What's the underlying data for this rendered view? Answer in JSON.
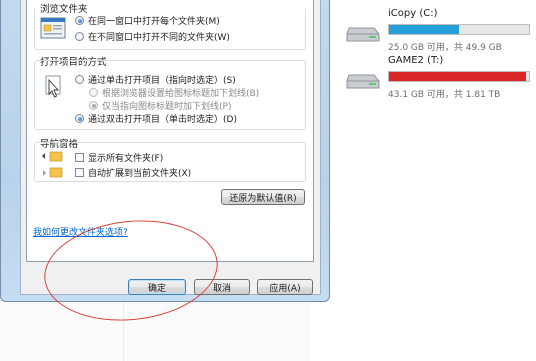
{
  "dialog": {
    "browse_group": {
      "title": "浏览文件夹",
      "options": [
        {
          "label": "在同一窗口中打开每个文件夹(M)",
          "selected": true
        },
        {
          "label": "在不同窗口中打开不同的文件夹(W)",
          "selected": false
        }
      ]
    },
    "click_group": {
      "title": "打开项目的方式",
      "options": [
        {
          "label": "通过单击打开项目（指向时选定）(S)",
          "selected": false,
          "disabled": false
        },
        {
          "label": "根据浏览器设置给图标标题加下划线(B)",
          "selected": false,
          "disabled": true
        },
        {
          "label": "仅当指向图标标题时加下划线(P)",
          "selected": true,
          "disabled": true
        },
        {
          "label": "通过双击打开项目（单击时选定）(D)",
          "selected": true,
          "disabled": false
        }
      ]
    },
    "nav_group": {
      "title": "导航窗格",
      "options": [
        {
          "label": "显示所有文件夹(F)",
          "checked": false
        },
        {
          "label": "自动扩展到当前文件夹(X)",
          "checked": false
        }
      ]
    },
    "restore_defaults_label": "还原为默认值(R)",
    "help_link": "我如何更改文件夹选项?",
    "buttons": {
      "ok": "确定",
      "cancel": "取消",
      "apply": "应用(A)"
    }
  },
  "explorer": {
    "drives": [
      {
        "name": "iCopy (C:)",
        "usage": "25.0 GB 可用，共 49.9 GB",
        "used_fraction": 0.5,
        "bar_color": "#26a0da"
      },
      {
        "name": "GAME2 (T:)",
        "usage": "43.1 GB 可用，共 1.81 TB",
        "used_fraction": 0.977,
        "bar_color": "#da2626"
      }
    ]
  },
  "colors": {
    "annotation": "#d9433b",
    "link": "#0066cc"
  }
}
